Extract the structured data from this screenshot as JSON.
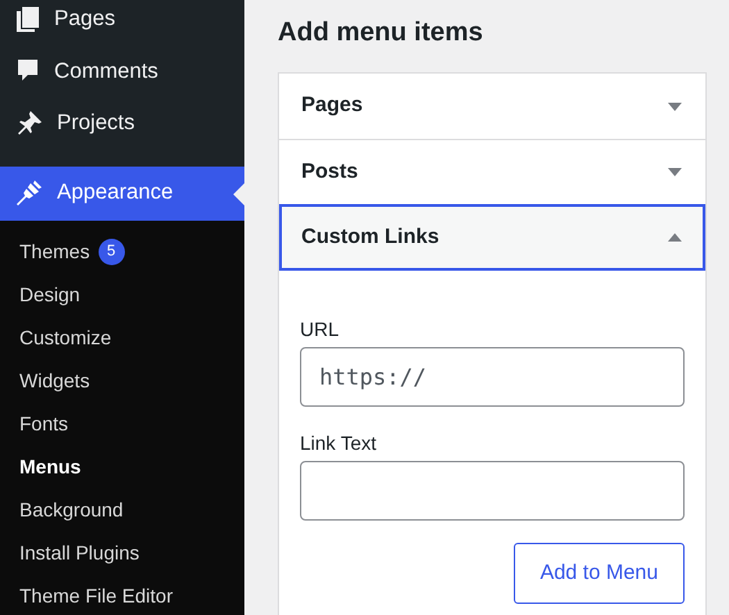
{
  "sidebar": {
    "items": [
      {
        "label": "Pages",
        "selected": false
      },
      {
        "label": "Comments",
        "selected": false
      },
      {
        "label": "Projects",
        "selected": false
      },
      {
        "label": "Appearance",
        "selected": true,
        "children": [
          {
            "label": "Themes",
            "badge": "5",
            "selected": false
          },
          {
            "label": "Design",
            "selected": false
          },
          {
            "label": "Customize",
            "selected": false
          },
          {
            "label": "Widgets",
            "selected": false
          },
          {
            "label": "Fonts",
            "selected": false
          },
          {
            "label": "Menus",
            "selected": true
          },
          {
            "label": "Background",
            "selected": false
          },
          {
            "label": "Install Plugins",
            "selected": false
          },
          {
            "label": "Theme File Editor",
            "selected": false
          }
        ]
      }
    ]
  },
  "main": {
    "title": "Add menu items",
    "panels": [
      {
        "title": "Pages",
        "expanded": false
      },
      {
        "title": "Posts",
        "expanded": false
      },
      {
        "title": "Custom Links",
        "expanded": true,
        "fields": [
          {
            "label": "URL",
            "value": "https://"
          },
          {
            "label": "Link Text"
          }
        ],
        "button": "Add to Menu"
      }
    ]
  }
}
